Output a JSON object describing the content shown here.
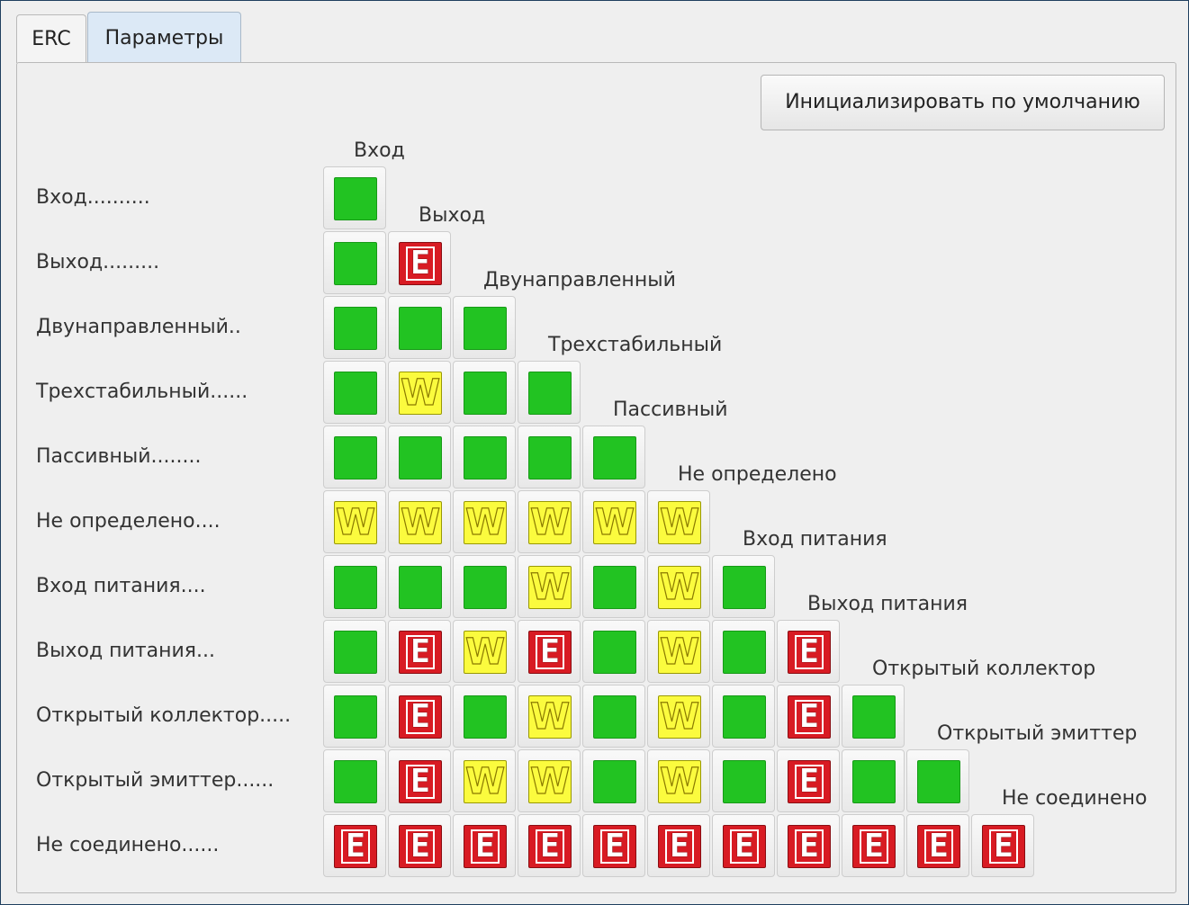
{
  "tabs": [
    {
      "label": "ERC",
      "active": false
    },
    {
      "label": "Параметры",
      "active": true
    }
  ],
  "reset_button": {
    "label": "Инициализировать по умолчанию"
  },
  "row_labels": [
    "Вход..........",
    "Выход.........",
    "Двунаправленный..",
    "Трехстабильный......",
    "Пассивный........",
    "Не определено....",
    "Вход питания....",
    "Выход питания...",
    "Открытый коллектор.....",
    "Открытый эмиттер......",
    "Не соединено......"
  ],
  "column_labels": [
    "Вход",
    "Выход",
    "Двунаправленный",
    "Трехстабильный",
    "Пассивный",
    "Не определено",
    "Вход питания",
    "Выход питания",
    "Открытый коллектор",
    "Открытый эмиттер",
    "Не соединено"
  ],
  "mark_text": {
    "error": "E",
    "warning": "W"
  },
  "colors": {
    "ok": "#22c322",
    "warning": "#fbfb3e",
    "error": "#d81b23",
    "tab_active": "#dce9f6"
  },
  "matrix": [
    [
      "ok"
    ],
    [
      "ok",
      "err"
    ],
    [
      "ok",
      "ok",
      "ok"
    ],
    [
      "ok",
      "warn",
      "ok",
      "ok"
    ],
    [
      "ok",
      "ok",
      "ok",
      "ok",
      "ok"
    ],
    [
      "warn",
      "warn",
      "warn",
      "warn",
      "warn",
      "warn"
    ],
    [
      "ok",
      "ok",
      "ok",
      "warn",
      "ok",
      "warn",
      "ok"
    ],
    [
      "ok",
      "err",
      "warn",
      "err",
      "ok",
      "warn",
      "ok",
      "err"
    ],
    [
      "ok",
      "err",
      "ok",
      "warn",
      "ok",
      "warn",
      "ok",
      "err",
      "ok"
    ],
    [
      "ok",
      "err",
      "warn",
      "warn",
      "ok",
      "warn",
      "ok",
      "err",
      "ok",
      "ok"
    ],
    [
      "err",
      "err",
      "err",
      "err",
      "err",
      "err",
      "err",
      "err",
      "err",
      "err",
      "err"
    ]
  ]
}
